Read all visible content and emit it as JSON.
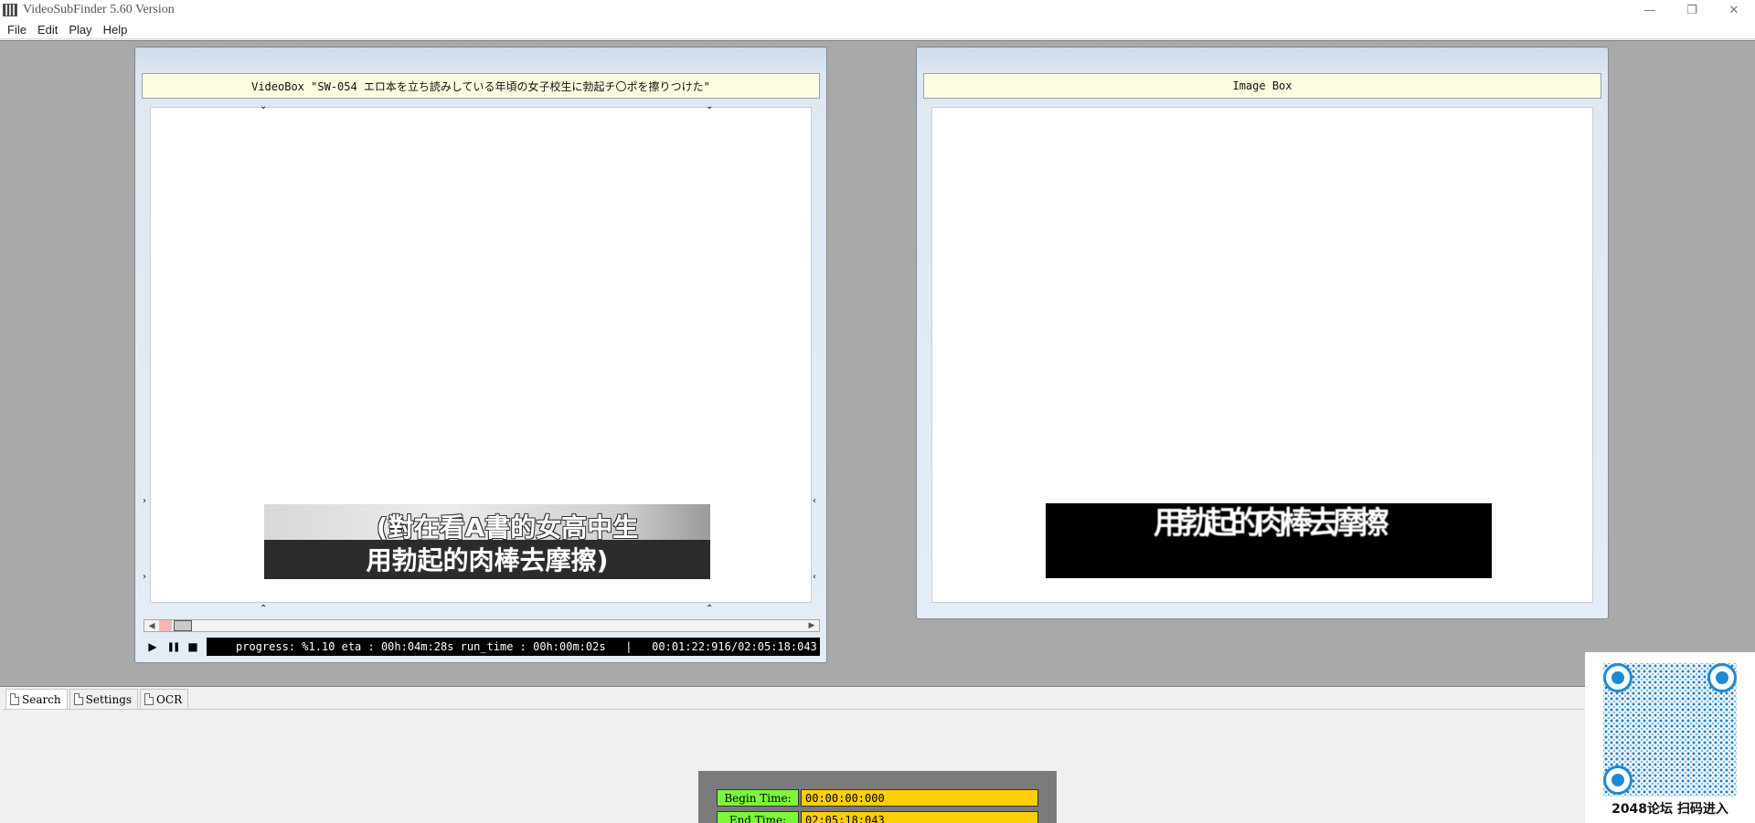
{
  "window": {
    "title": "VideoSubFinder 5.60 Version",
    "controls": {
      "minimize": "—",
      "restore": "❐",
      "close": "✕"
    }
  },
  "menu": [
    "File",
    "Edit",
    "Play",
    "Help"
  ],
  "video_box": {
    "title": "VideoBox \"SW-054 エロ本を立ち読みしている年頃の女子校生に勃起チ〇ポを擦りつけた\"",
    "subtitle_lines": [
      "(對在看A書的女高中生",
      "用勃起的肉棒去摩擦)"
    ],
    "status": "progress: %1.10 eta : 00h:04m:28s run_time : 00h:00m:02s   |   00:01:22:916/02:05:18:043",
    "controls": {
      "play": "▶",
      "pause": "❚❚",
      "stop": "■"
    },
    "marker_glyphs": {
      "down": "⌄",
      "up": "⌃",
      "right": "›",
      "left": "‹"
    }
  },
  "image_box": {
    "title": "Image Box",
    "image_text": "用勃起的肉棒去摩擦"
  },
  "tabs": [
    {
      "label": "Search",
      "active": true
    },
    {
      "label": "Settings",
      "active": false
    },
    {
      "label": "OCR",
      "active": false
    }
  ],
  "time_panel": {
    "begin_label": "Begin Time:",
    "begin_value": "00:00:00:000",
    "end_label": "End Time:",
    "end_value": "02:05:18:043"
  },
  "qr": {
    "caption": "2048论坛 扫码进入"
  },
  "colors": {
    "workspace": "#a9a9a9",
    "header": "#fdfbe0",
    "time_label": "#7cf83a",
    "time_value": "#fccf06",
    "qr_blue": "#1e8ad6"
  }
}
